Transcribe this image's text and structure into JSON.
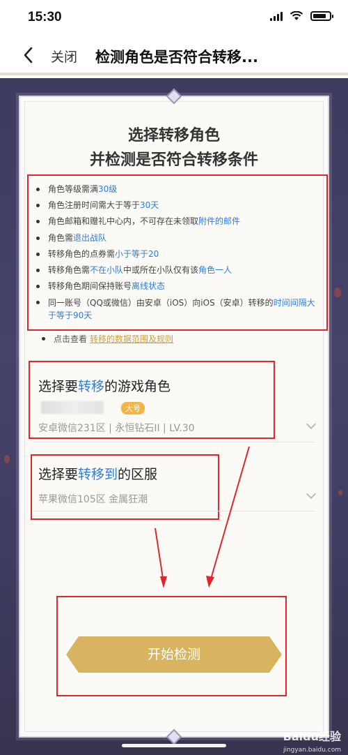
{
  "status": {
    "time": "15:30"
  },
  "nav": {
    "close_label": "关闭",
    "title": "检测角色是否符合转移..."
  },
  "card": {
    "title_line1": "选择转移角色",
    "title_line2": "并检测是否符合转移条件"
  },
  "rules": [
    {
      "pre": "角色等级需满",
      "hl": "30级",
      "post": ""
    },
    {
      "pre": "角色注册时间需大于等于",
      "hl": "30天",
      "post": ""
    },
    {
      "pre": "角色邮箱和赠礼中心内，不可存在未领取",
      "hl": "附件的邮件",
      "post": ""
    },
    {
      "pre": "角色需",
      "hl": "退出战队",
      "post": ""
    },
    {
      "pre": "转移角色的点券需",
      "hl": "小于等于20",
      "post": ""
    },
    {
      "pre": "转移角色需",
      "hl": "不在小队",
      "mid": "中或所在小队仅有该",
      "hl2": "角色一人"
    },
    {
      "pre": "转移角色期间保持账号",
      "hl": "离线状态",
      "post": ""
    },
    {
      "pre": "同一账号（QQ或微信）由安卓（iOS）向iOS（安卓）转移的",
      "hl": "时间间隔大于等于90天",
      "post": ""
    }
  ],
  "view": {
    "text": "点击查看",
    "link": "转移的数据范围及规则"
  },
  "select_role": {
    "title_pre": "选择要",
    "title_hl": "转移",
    "title_post": "的游戏角色",
    "badge": "大号",
    "detail": "安卓微信231区 | 永恒钻石II | LV.30"
  },
  "select_server": {
    "title_pre": "选择要",
    "title_hl": "转移到",
    "title_post": "的区服",
    "detail": "苹果微信105区 金属狂潮"
  },
  "start_button": {
    "label": "开始检测"
  },
  "watermark": {
    "logo": "Baidu经验",
    "site": "jingyan.baidu.com"
  },
  "colors": {
    "accent": "#2f7ed8",
    "gold": "#c9a042",
    "annotation": "#e0262d",
    "bg": "#3d3c5e"
  },
  "icons": [
    "back-icon",
    "signal-icon",
    "wifi-icon",
    "battery-icon",
    "chevron-down-icon"
  ]
}
